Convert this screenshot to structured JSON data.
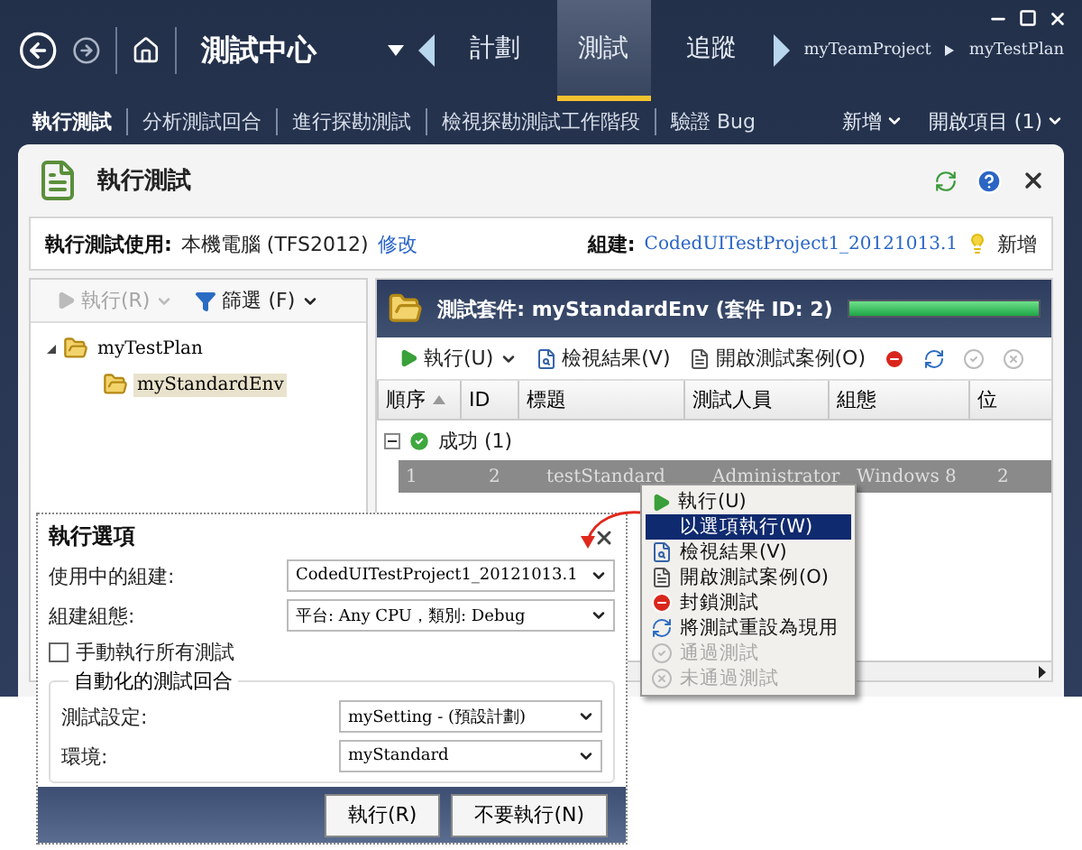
{
  "nav": {
    "title": "測試中心",
    "tabs": [
      {
        "label": "計劃",
        "selected": false
      },
      {
        "label": "測試",
        "selected": true
      },
      {
        "label": "追蹤",
        "selected": false
      }
    ],
    "breadcrumb": [
      "myTeamProject",
      "myTestPlan"
    ]
  },
  "subnav": {
    "items": [
      {
        "label": "執行測試",
        "selected": true
      },
      {
        "label": "分析測試回合",
        "selected": false
      },
      {
        "label": "進行探勘測試",
        "selected": false
      },
      {
        "label": "檢視探勘測試工作階段",
        "selected": false
      },
      {
        "label": "驗證 Bug",
        "selected": false
      }
    ],
    "actions": [
      "新增",
      "開啟項目 (1)"
    ]
  },
  "panel": {
    "title": "執行測試",
    "run_with": {
      "label": "執行測試使用:",
      "value": "本機電腦 (TFS2012)",
      "link": "修改"
    },
    "build": {
      "label": "組建:",
      "value": "CodedUITestProject1_20121013.1",
      "action": "新增"
    }
  },
  "left_pane": {
    "toolbar": [
      {
        "kind": "run",
        "label": "執行(R)",
        "disabled": true
      },
      {
        "kind": "filter",
        "label": "篩選 (F)",
        "disabled": false
      }
    ],
    "tree": [
      {
        "label": "myTestPlan",
        "selected": false,
        "expanded": true,
        "children": [
          {
            "label": "myStandardEnv",
            "selected": true
          }
        ]
      }
    ]
  },
  "suite": {
    "title": "測試套件:  myStandardEnv (套件 ID: 2)",
    "level": 1,
    "toolbar": [
      {
        "kind": "run",
        "label": "執行(U)",
        "disabled": false
      },
      {
        "kind": "view",
        "label": "檢視結果(V)",
        "disabled": false
      },
      {
        "kind": "open",
        "label": "開啟測試案例(O)",
        "disabled": false
      },
      {
        "kind": "block",
        "disabled": false
      },
      {
        "kind": "reset",
        "disabled": false
      },
      {
        "kind": "pass",
        "disabled": true
      },
      {
        "kind": "fail",
        "disabled": true
      }
    ],
    "columns": [
      {
        "label": "順序",
        "sorted": true
      },
      {
        "label": "ID",
        "sorted": false
      },
      {
        "label": "標題",
        "sorted": false
      },
      {
        "label": "測試人員",
        "sorted": false
      },
      {
        "label": "組態",
        "sorted": false
      },
      {
        "label": "位",
        "sorted": false
      }
    ],
    "groups": [
      {
        "label": "成功 (1)",
        "expanded": true,
        "rows": [
          {
            "selected": true,
            "cells": [
              "1",
              "2",
              "testStandard",
              "Administrator",
              "Windows 8",
              "2"
            ]
          }
        ]
      }
    ]
  },
  "context_menu": {
    "items": [
      {
        "kind": "run",
        "label": "執行(U)",
        "selected": false,
        "disabled": false
      },
      {
        "kind": "none",
        "label": "以選項執行(W)",
        "selected": true,
        "disabled": false
      },
      {
        "kind": "view",
        "label": "檢視結果(V)",
        "selected": false,
        "disabled": false
      },
      {
        "kind": "open",
        "label": "開啟測試案例(O)",
        "selected": false,
        "disabled": false
      },
      {
        "kind": "block",
        "label": "封鎖測試",
        "selected": false,
        "disabled": false
      },
      {
        "kind": "reset",
        "label": "將測試重設為現用",
        "selected": false,
        "disabled": false
      },
      {
        "kind": "pass",
        "label": "通過測試",
        "selected": false,
        "disabled": true
      },
      {
        "kind": "fail",
        "label": "未通過測試",
        "selected": false,
        "disabled": true
      }
    ]
  },
  "dialog": {
    "title": "執行選項",
    "fields": [
      {
        "label": "使用中的組建:",
        "value": "CodedUITestProject1_20121013.1"
      },
      {
        "label": "組建組態:",
        "value": "平台: Any CPU，類別: Debug"
      }
    ],
    "checkbox": {
      "label": "手動執行所有測試",
      "checked": false
    },
    "group": {
      "title": "自動化的測試回合",
      "fields": [
        {
          "label": "測試設定:",
          "value": "mySetting - (預設計劃)"
        },
        {
          "label": "環境:",
          "value": "myStandard"
        }
      ]
    },
    "buttons": [
      "執行(R)",
      "不要執行(N)"
    ]
  }
}
